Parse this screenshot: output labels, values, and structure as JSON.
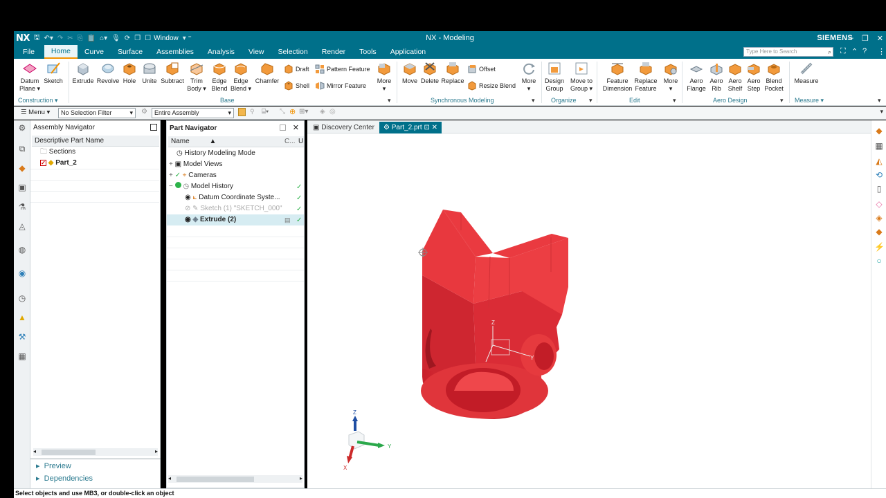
{
  "titlebar": {
    "logo": "NX",
    "window_label": "Window",
    "title": "NX - Modeling",
    "brand": "SIEMENS"
  },
  "menu": {
    "tabs": [
      "File",
      "Home",
      "Curve",
      "Surface",
      "Assemblies",
      "Analysis",
      "View",
      "Selection",
      "Render",
      "Tools",
      "Application"
    ],
    "active": "Home",
    "search_placeholder": "Type Here to Search"
  },
  "ribbon": {
    "construction": {
      "group": "Construction",
      "datum_plane": [
        "Datum",
        "Plane ▾"
      ],
      "sketch": "Sketch"
    },
    "base": {
      "group": "Base",
      "extrude": "Extrude",
      "revolve": "Revolve",
      "hole": "Hole",
      "unite": "Unite",
      "subtract": "Subtract",
      "trim_body": [
        "Trim",
        "Body ▾"
      ],
      "edge_blend": [
        "Edge",
        "Blend"
      ],
      "edge_blend2": [
        "Edge",
        "Blend ▾"
      ],
      "chamfer": "Chamfer",
      "draft": "Draft",
      "shell": "Shell",
      "pattern_feature": "Pattern Feature",
      "mirror_feature": "Mirror Feature",
      "more": [
        "More",
        "▾"
      ]
    },
    "sync": {
      "group": "Synchronous Modeling",
      "move": "Move",
      "delete": "Delete",
      "replace": "Replace",
      "offset": "Offset",
      "resize_blend": "Resize Blend",
      "more": [
        "More",
        "▾"
      ]
    },
    "organize": {
      "group": "Organize",
      "design_group": [
        "Design",
        "Group"
      ],
      "move_to_group": [
        "Move to",
        "Group ▾"
      ]
    },
    "edit": {
      "group": "Edit",
      "feature_dimension": [
        "Feature",
        "Dimension"
      ],
      "replace_feature": [
        "Replace",
        "Feature"
      ],
      "more": [
        "More",
        "▾"
      ]
    },
    "aero": {
      "group": "Aero Design",
      "aero_flange": [
        "Aero",
        "Flange"
      ],
      "aero_rib": [
        "Aero",
        "Rib"
      ],
      "aero_shelf": [
        "Aero",
        "Shelf"
      ],
      "aero_step": [
        "Aero",
        "Step"
      ],
      "blend_pocket": [
        "Blend",
        "Pocket"
      ]
    },
    "measure": {
      "group": "Measure ▾",
      "measure": "Measure"
    }
  },
  "selection_bar": {
    "menu": "Menu ▾",
    "filter": "No Selection Filter",
    "scope": "Entire Assembly"
  },
  "assembly_navigator": {
    "title": "Assembly Navigator",
    "column": "Descriptive Part Name",
    "rows": [
      "Sections",
      "Part_2"
    ],
    "footer": [
      "Preview",
      "Dependencies"
    ]
  },
  "part_navigator": {
    "title": "Part Navigator",
    "columns": [
      "Name",
      "C...",
      "U"
    ],
    "rows": [
      {
        "label": "History Modeling Mode"
      },
      {
        "label": "Model Views"
      },
      {
        "label": "Cameras"
      },
      {
        "label": "Model History"
      },
      {
        "label": "Datum Coordinate Syste..."
      },
      {
        "label": "Sketch (1) \"SKETCH_000\""
      },
      {
        "label": "Extrude (2)"
      }
    ]
  },
  "graphics": {
    "tabs": [
      "Discovery Center",
      "Part_2.prt"
    ],
    "active_tab": "Part_2.prt",
    "model_color": "#e63a3e",
    "axis_labels": {
      "z": "Z",
      "y": "Y",
      "x": "X"
    }
  },
  "status": {
    "text": "Select objects and use MB3, or double-click an object"
  },
  "colors": {
    "chrome": "#00708a",
    "accent": "#f39200"
  }
}
